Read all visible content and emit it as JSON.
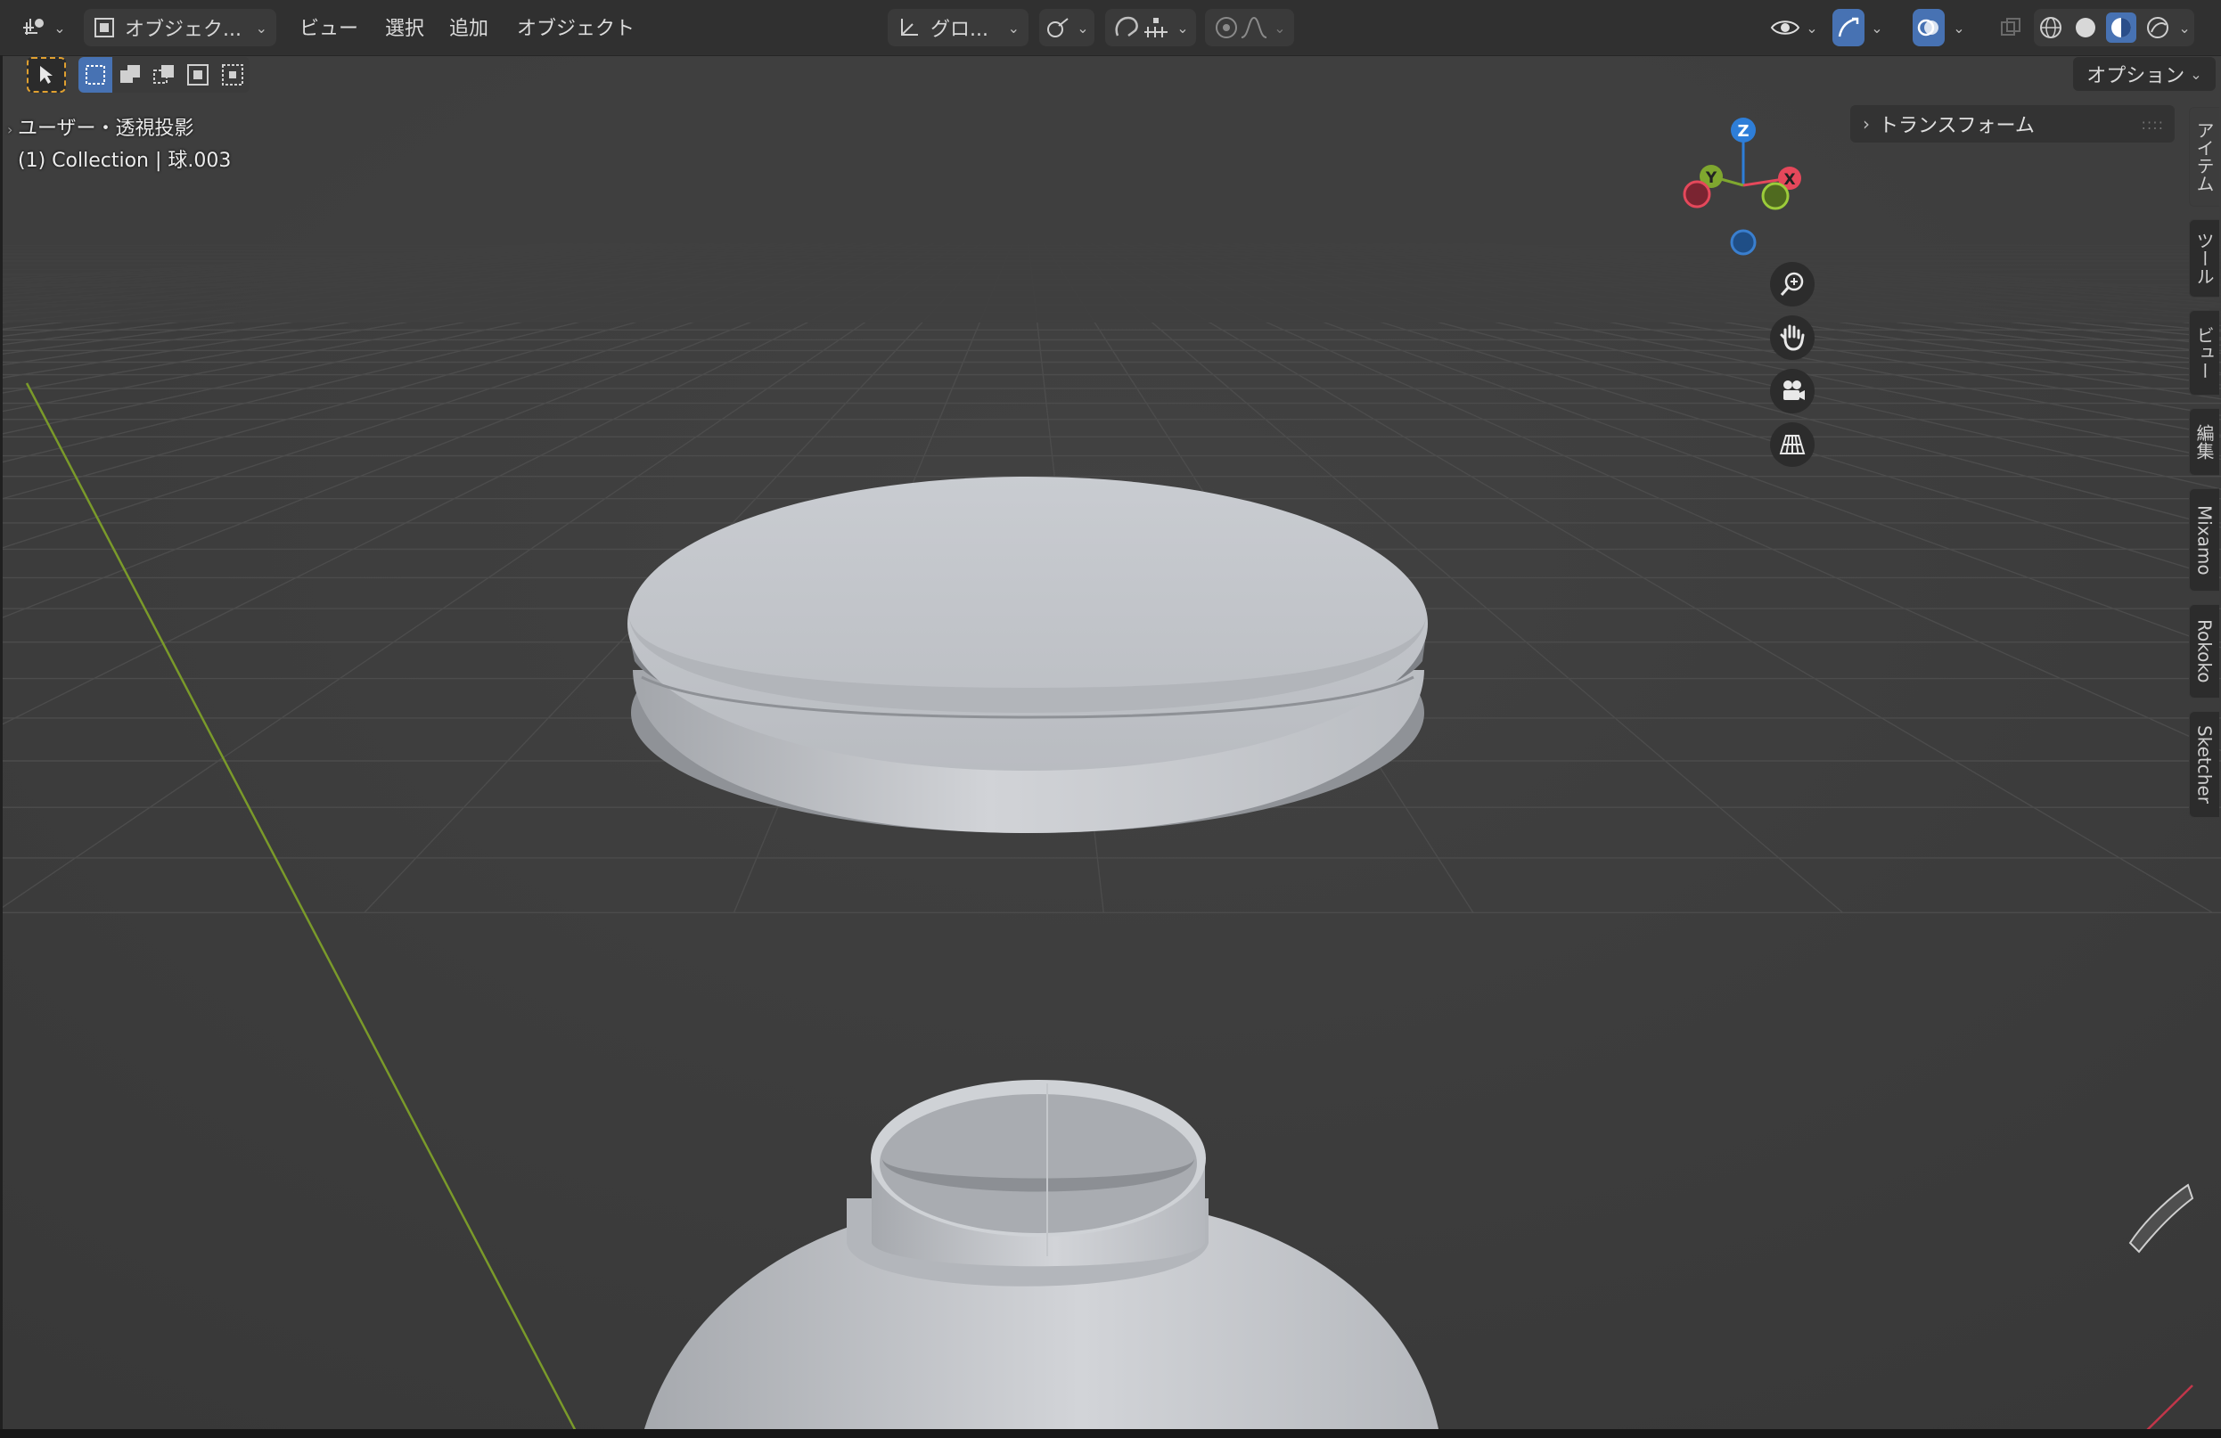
{
  "header": {
    "editor_type_icon": "3d-viewport-icon",
    "mode_label": "オブジェク...",
    "menus": [
      "ビュー",
      "選択",
      "追加",
      "オブジェクト"
    ],
    "orientation_label": "グロ...",
    "pivot_icon": "pivot-icon",
    "snap_icon": "snap-magnet-icon",
    "proportional_icon": "proportional-edit-icon"
  },
  "toolbar": {
    "options_label": "オプション"
  },
  "viewport": {
    "view_name": "ユーザー・透視投影",
    "collection_label": "(1) Collection | 球.003",
    "gizmo_axes": [
      "Z",
      "Y",
      "X"
    ]
  },
  "npanel": {
    "transform_label": "トランスフォーム",
    "tabs": [
      "アイテム",
      "ツール",
      "ビュー",
      "編集",
      "Mixamo",
      "Rokoko",
      "Sketcher"
    ]
  },
  "colors": {
    "accent": "#4772b3",
    "axis_x": "#e5485b",
    "axis_y": "#7fa72f",
    "axis_z": "#2e7ed8",
    "grid_bg": "#3d3d3d"
  }
}
